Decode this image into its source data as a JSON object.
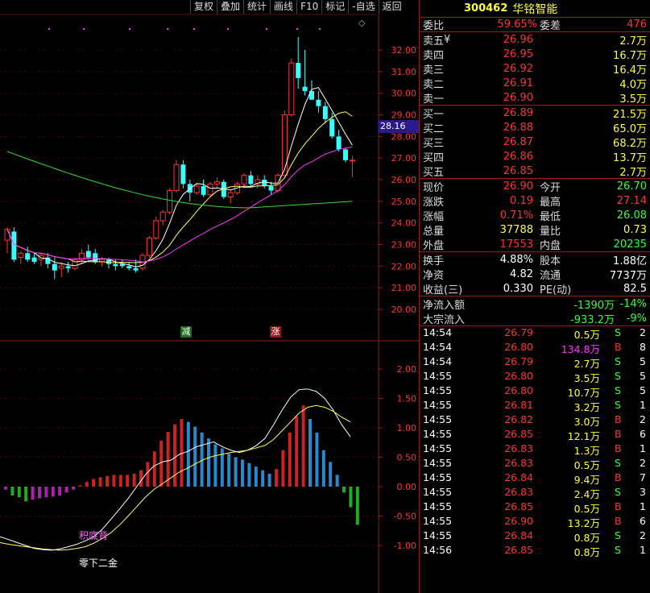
{
  "toolbar": {
    "buttons": [
      "复权",
      "叠加",
      "统计",
      "画线",
      "F10",
      "标记",
      "-自选",
      "返回"
    ]
  },
  "header": {
    "code": "300462",
    "name": "华铭智能"
  },
  "weibi": {
    "label1": "委比",
    "value1": "59.65%",
    "label2": "委差",
    "value2": "476"
  },
  "asks": [
    {
      "label": "卖五",
      "flag": "¥",
      "price": "26.96",
      "vol": "2.7万"
    },
    {
      "label": "卖四",
      "flag": "",
      "price": "26.95",
      "vol": "16.7万"
    },
    {
      "label": "卖三",
      "flag": "",
      "price": "26.92",
      "vol": "16.4万"
    },
    {
      "label": "卖二",
      "flag": "",
      "price": "26.91",
      "vol": "4.0万"
    },
    {
      "label": "卖一",
      "flag": "",
      "price": "26.90",
      "vol": "3.5万"
    }
  ],
  "bids": [
    {
      "label": "买一",
      "price": "26.89",
      "vol": "21.5万"
    },
    {
      "label": "买二",
      "price": "26.88",
      "vol": "65.0万"
    },
    {
      "label": "买三",
      "price": "26.87",
      "vol": "68.2万"
    },
    {
      "label": "买四",
      "price": "26.86",
      "vol": "13.7万"
    },
    {
      "label": "买五",
      "price": "26.85",
      "vol": "2.7万"
    }
  ],
  "stats": [
    {
      "l1": "现价",
      "v1": "26.90",
      "c1": "red",
      "l2": "今开",
      "v2": "26.70",
      "c2": "grn"
    },
    {
      "l1": "涨跌",
      "v1": "0.19",
      "c1": "red",
      "l2": "最高",
      "v2": "27.14",
      "c2": "red"
    },
    {
      "l1": "涨幅",
      "v1": "0.71%",
      "c1": "red",
      "l2": "最低",
      "v2": "26.08",
      "c2": "grn"
    },
    {
      "l1": "总量",
      "v1": "37788",
      "c1": "yel",
      "l2": "量比",
      "v2": "0.73",
      "c2": "yel"
    },
    {
      "l1": "外盘",
      "v1": "17553",
      "c1": "red",
      "l2": "内盘",
      "v2": "20235",
      "c2": "grn"
    }
  ],
  "fundamentals": [
    {
      "l1": "换手",
      "v1": "4.88%",
      "l2": "股本",
      "v2": "1.88亿"
    },
    {
      "l1": "净资",
      "v1": "4.82",
      "l2": "流通",
      "v2": "7737万"
    },
    {
      "l1": "收益(三)",
      "v1": "0.330",
      "l2": "PE(动)",
      "v2": "82.5"
    }
  ],
  "flows": [
    {
      "label": "净流入额",
      "value": "-1390万",
      "pct": "-14%"
    },
    {
      "label": "大宗流入",
      "value": "-933.2万",
      "pct": "-9%"
    }
  ],
  "trades": [
    {
      "time": "14:54",
      "price": "26.79",
      "vol": "0.5万",
      "side": "S",
      "n": "2",
      "pc": "red",
      "vc": "yel"
    },
    {
      "time": "14:54",
      "price": "26.80",
      "vol": "134.8万",
      "side": "B",
      "n": "8",
      "pc": "red",
      "vc": "mag"
    },
    {
      "time": "14:54",
      "price": "26.79",
      "vol": "2.7万",
      "side": "S",
      "n": "5",
      "pc": "red",
      "vc": "yel"
    },
    {
      "time": "14:55",
      "price": "26.80",
      "vol": "3.5万",
      "side": "S",
      "n": "5",
      "pc": "red",
      "vc": "yel"
    },
    {
      "time": "14:55",
      "price": "26.80",
      "vol": "10.7万",
      "side": "S",
      "n": "5",
      "pc": "red",
      "vc": "yel"
    },
    {
      "time": "14:55",
      "price": "26.81",
      "vol": "3.2万",
      "side": "S",
      "n": "1",
      "pc": "red",
      "vc": "yel"
    },
    {
      "time": "14:55",
      "price": "26.82",
      "vol": "3.0万",
      "side": "B",
      "n": "2",
      "pc": "red",
      "vc": "yel"
    },
    {
      "time": "14:55",
      "price": "26.85",
      "vol": "12.1万",
      "side": "B",
      "n": "6",
      "pc": "red",
      "vc": "yel"
    },
    {
      "time": "14:55",
      "price": "26.83",
      "vol": "1.3万",
      "side": "B",
      "n": "1",
      "pc": "red",
      "vc": "yel"
    },
    {
      "time": "14:55",
      "price": "26.83",
      "vol": "0.5万",
      "side": "S",
      "n": "2",
      "pc": "red",
      "vc": "yel"
    },
    {
      "time": "14:55",
      "price": "26.84",
      "vol": "9.4万",
      "side": "B",
      "n": "7",
      "pc": "red",
      "vc": "yel"
    },
    {
      "time": "14:55",
      "price": "26.83",
      "vol": "2.4万",
      "side": "S",
      "n": "3",
      "pc": "red",
      "vc": "yel"
    },
    {
      "time": "14:55",
      "price": "26.85",
      "vol": "0.5万",
      "side": "B",
      "n": "1",
      "pc": "red",
      "vc": "yel"
    },
    {
      "time": "14:55",
      "price": "26.90",
      "vol": "13.2万",
      "side": "B",
      "n": "6",
      "pc": "red",
      "vc": "yel"
    },
    {
      "time": "14:55",
      "price": "26.84",
      "vol": "0.8万",
      "side": "S",
      "n": "2",
      "pc": "red",
      "vc": "yel"
    },
    {
      "time": "14:56",
      "price": "26.85",
      "vol": "0.8万",
      "side": "S",
      "n": "1",
      "pc": "red",
      "vc": "yel"
    }
  ],
  "chart": {
    "price_ticks": [
      "32.00",
      "31.00",
      "30.00",
      "29.00",
      "28.00",
      "27.00",
      "26.00",
      "25.00",
      "24.00",
      "23.00",
      "22.00",
      "21.00",
      "20.00"
    ],
    "macd_ticks": [
      "2.00",
      "1.50",
      "1.00",
      "0.50",
      "0.00",
      "-0.50",
      "-1.00"
    ],
    "current_price_label": "28.16",
    "marker_jian": "减",
    "marker_zhang": "涨",
    "signal_jdb": "积底背",
    "signal_lxej": "零下二金"
  },
  "colors": {
    "up": "#ff3333",
    "down": "#33ffff",
    "ma1": "#ffffff",
    "ma2": "#ffff66",
    "ma3": "#ff33ff",
    "ma4": "#33dd33",
    "accent_bg": "#2a1a8e"
  }
}
